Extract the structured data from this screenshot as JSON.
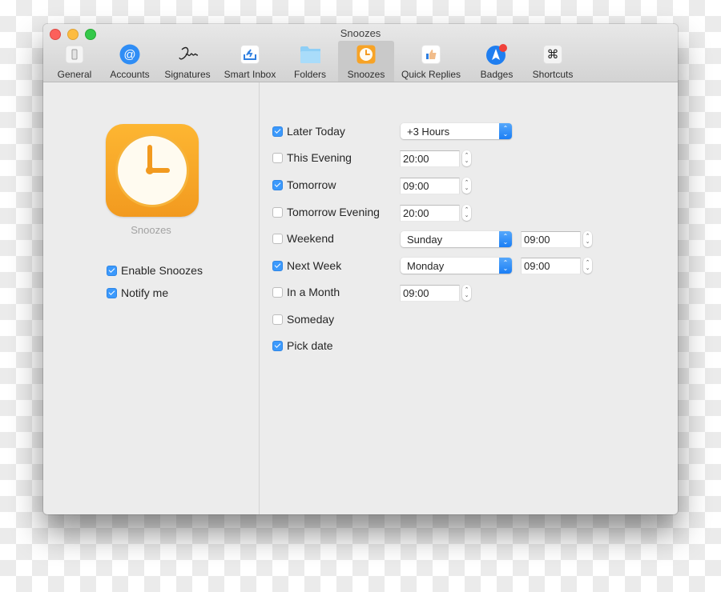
{
  "window": {
    "title": "Snoozes",
    "traffic_lights": [
      "close",
      "minimize",
      "zoom"
    ]
  },
  "toolbar": {
    "tabs": [
      {
        "label": "General",
        "icon": "toggle-switch-icon"
      },
      {
        "label": "Accounts",
        "icon": "at-sign-icon"
      },
      {
        "label": "Signatures",
        "icon": "signature-icon"
      },
      {
        "label": "Smart Inbox",
        "icon": "smart-inbox-icon"
      },
      {
        "label": "Folders",
        "icon": "folder-icon"
      },
      {
        "label": "Snoozes",
        "icon": "clock-icon",
        "active": true
      },
      {
        "label": "Quick Replies",
        "icon": "thumbs-up-icon"
      },
      {
        "label": "Badges",
        "icon": "paper-plane-badge-icon"
      },
      {
        "label": "Shortcuts",
        "icon": "command-key-icon"
      }
    ]
  },
  "left": {
    "app_label": "Snoozes",
    "options": [
      {
        "label": "Enable Snoozes",
        "checked": true
      },
      {
        "label": "Notify me",
        "checked": true
      }
    ]
  },
  "snoozes": [
    {
      "label": "Later Today",
      "checked": true,
      "select": "+3 Hours"
    },
    {
      "label": "This Evening",
      "checked": false,
      "time": "20:00"
    },
    {
      "label": "Tomorrow",
      "checked": true,
      "time": "09:00"
    },
    {
      "label": "Tomorrow Evening",
      "checked": false,
      "time": "20:00"
    },
    {
      "label": "Weekend",
      "checked": false,
      "select": "Sunday",
      "time": "09:00"
    },
    {
      "label": "Next Week",
      "checked": true,
      "select": "Monday",
      "time": "09:00"
    },
    {
      "label": "In a Month",
      "checked": false,
      "time": "09:00"
    },
    {
      "label": "Someday",
      "checked": false
    },
    {
      "label": "Pick date",
      "checked": true
    }
  ],
  "colors": {
    "accent": "#3b99fc",
    "snooze_orange": "#f7a326",
    "badge_red": "#f0413a"
  }
}
